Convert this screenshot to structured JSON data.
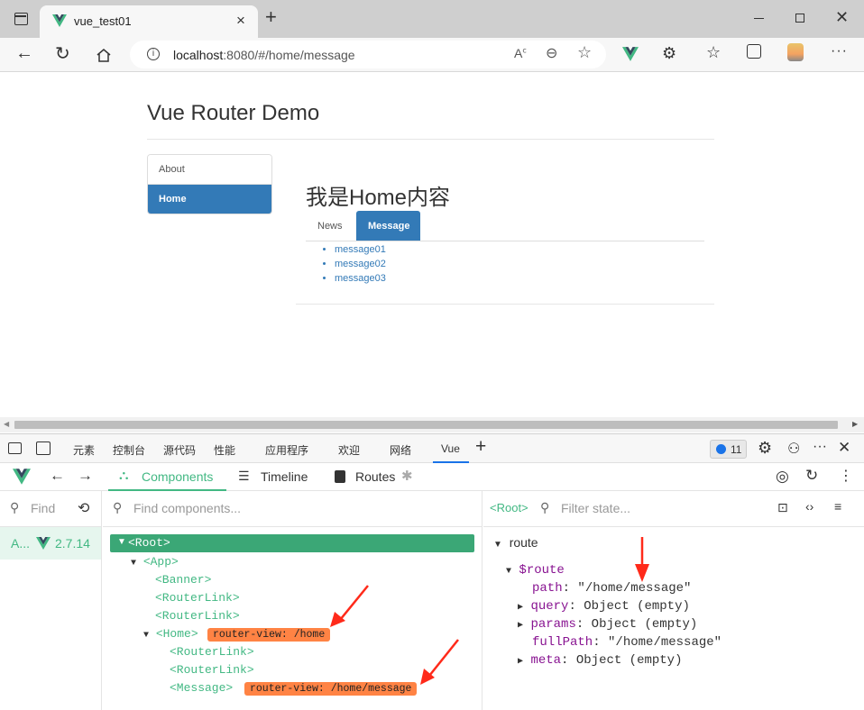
{
  "browser": {
    "tab_title": "vue_test01",
    "url_host": "localhost",
    "url_rest": ":8080/#/home/message"
  },
  "page": {
    "heading": "Vue Router Demo",
    "nav": [
      {
        "label": "About"
      },
      {
        "label": "Home"
      }
    ],
    "home_title": "我是Home内容",
    "subtabs": [
      {
        "label": "News"
      },
      {
        "label": "Message"
      }
    ],
    "messages": [
      "message01",
      "message02",
      "message03"
    ]
  },
  "devtools": {
    "tabs": [
      "元素",
      "控制台",
      "源代码",
      "性能",
      "应用程序",
      "欢迎",
      "网络",
      "Vue"
    ],
    "issues_count": "11",
    "vue_tabs": [
      {
        "label": "Components"
      },
      {
        "label": "Timeline"
      },
      {
        "label": "Routes"
      }
    ],
    "find_label": "Find",
    "app_label": "A...",
    "vue_version": "2.7.14",
    "find_components_placeholder": "Find components...",
    "root_tag": "<Root>",
    "filter_state_placeholder": "Filter state...",
    "tree": [
      {
        "tag": "<Root>"
      },
      {
        "tag": "<App>"
      },
      {
        "tag": "<Banner>"
      },
      {
        "tag": "<RouterLink>"
      },
      {
        "tag": "<RouterLink>"
      },
      {
        "tag": "<Home>",
        "badge": "router-view: /home"
      },
      {
        "tag": "<RouterLink>"
      },
      {
        "tag": "<RouterLink>"
      },
      {
        "tag": "<Message>",
        "badge": "router-view: /home/message"
      }
    ],
    "state": {
      "section": "route",
      "object": "$route",
      "rows": [
        {
          "key": "path",
          "value": "\"/home/message\""
        },
        {
          "key": "query",
          "value": "Object (empty)"
        },
        {
          "key": "params",
          "value": "Object (empty)"
        },
        {
          "key": "fullPath",
          "value": "\"/home/message\""
        },
        {
          "key": "meta",
          "value": "Object (empty)"
        }
      ]
    }
  },
  "colors": {
    "vue_green": "#42b883",
    "bootstrap_blue": "#337ab7",
    "badge_orange": "#ff8344",
    "arrow_red": "#ff2a1a"
  }
}
